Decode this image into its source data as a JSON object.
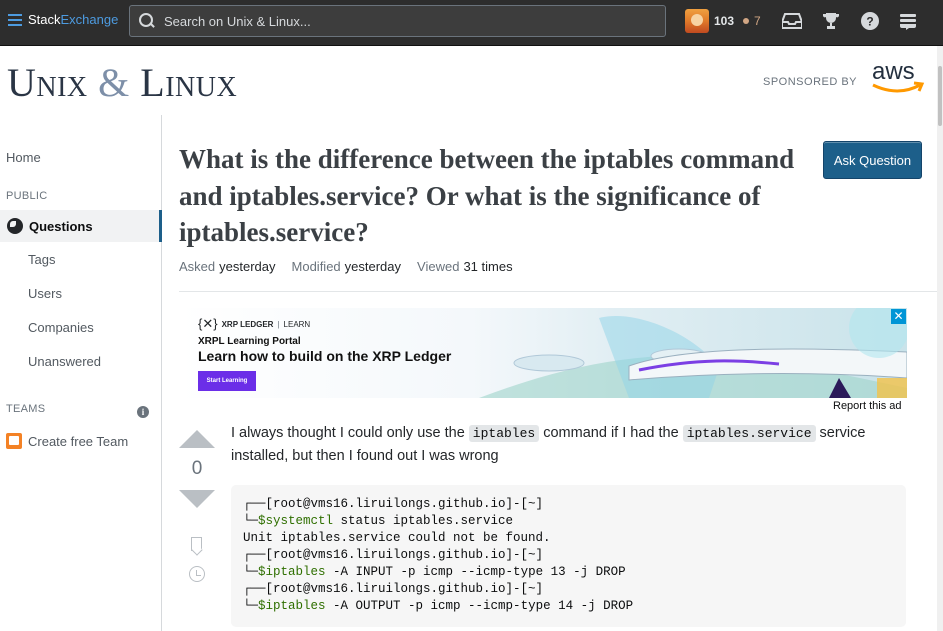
{
  "topbar": {
    "logo_stack": "Stack",
    "logo_exchange": "Exchange",
    "search_placeholder": "Search on Unix & Linux...",
    "reputation": "103",
    "bronze_badges": "7",
    "icons": [
      "inbox-icon",
      "achievements-icon",
      "help-icon",
      "site-switcher-icon"
    ]
  },
  "site": {
    "name_part1": "Unix",
    "name_amp": "&",
    "name_part2": "Linux",
    "sponsored_by": "SPONSORED BY",
    "sponsor_logo": "aws"
  },
  "sidebar": {
    "home": "Home",
    "public_label": "PUBLIC",
    "questions": "Questions",
    "items": [
      "Tags",
      "Users",
      "Companies",
      "Unanswered"
    ],
    "teams_label": "TEAMS",
    "create_team": "Create free Team"
  },
  "question": {
    "title": "What is the difference between the iptables command and iptables.service? Or what is the significance of iptables.service?",
    "ask_button": "Ask Question",
    "asked_label": "Asked",
    "asked_value": "yesterday",
    "modified_label": "Modified",
    "modified_value": "yesterday",
    "viewed_label": "Viewed",
    "viewed_value": "31 times",
    "score": "0",
    "body_part1": "I always thought I could only use the ",
    "body_code1": "iptables",
    "body_part2": " command if I had the ",
    "body_code2": "iptables.service",
    "body_part3": " service installed, but then I found out I was wrong",
    "code_lines": [
      {
        "prefix": "┌──[root@vms16.liruilongs.github.io]-[~]",
        "cmd": "",
        "rest": ""
      },
      {
        "prefix": "└─",
        "cmd": "$systemctl",
        "rest": " status iptables.service"
      },
      {
        "prefix": "Unit iptables.service could not be found.",
        "cmd": "",
        "rest": ""
      },
      {
        "prefix": "┌──[root@vms16.liruilongs.github.io]-[~]",
        "cmd": "",
        "rest": ""
      },
      {
        "prefix": "└─",
        "cmd": "$iptables",
        "rest": " -A INPUT -p icmp --icmp-type 13 -j DROP"
      },
      {
        "prefix": "┌──[root@vms16.liruilongs.github.io]-[~]",
        "cmd": "",
        "rest": ""
      },
      {
        "prefix": "└─",
        "cmd": "$iptables",
        "rest": " -A OUTPUT -p icmp --icmp-type 14 -j DROP"
      }
    ]
  },
  "ad": {
    "brand": "XRP LEDGER",
    "brand_tag": "LEARN",
    "subtitle": "XRPL Learning Portal",
    "headline": "Learn how to build on the XRP Ledger",
    "button": "Start Learning",
    "close": "✕",
    "report": "Report this ad"
  }
}
